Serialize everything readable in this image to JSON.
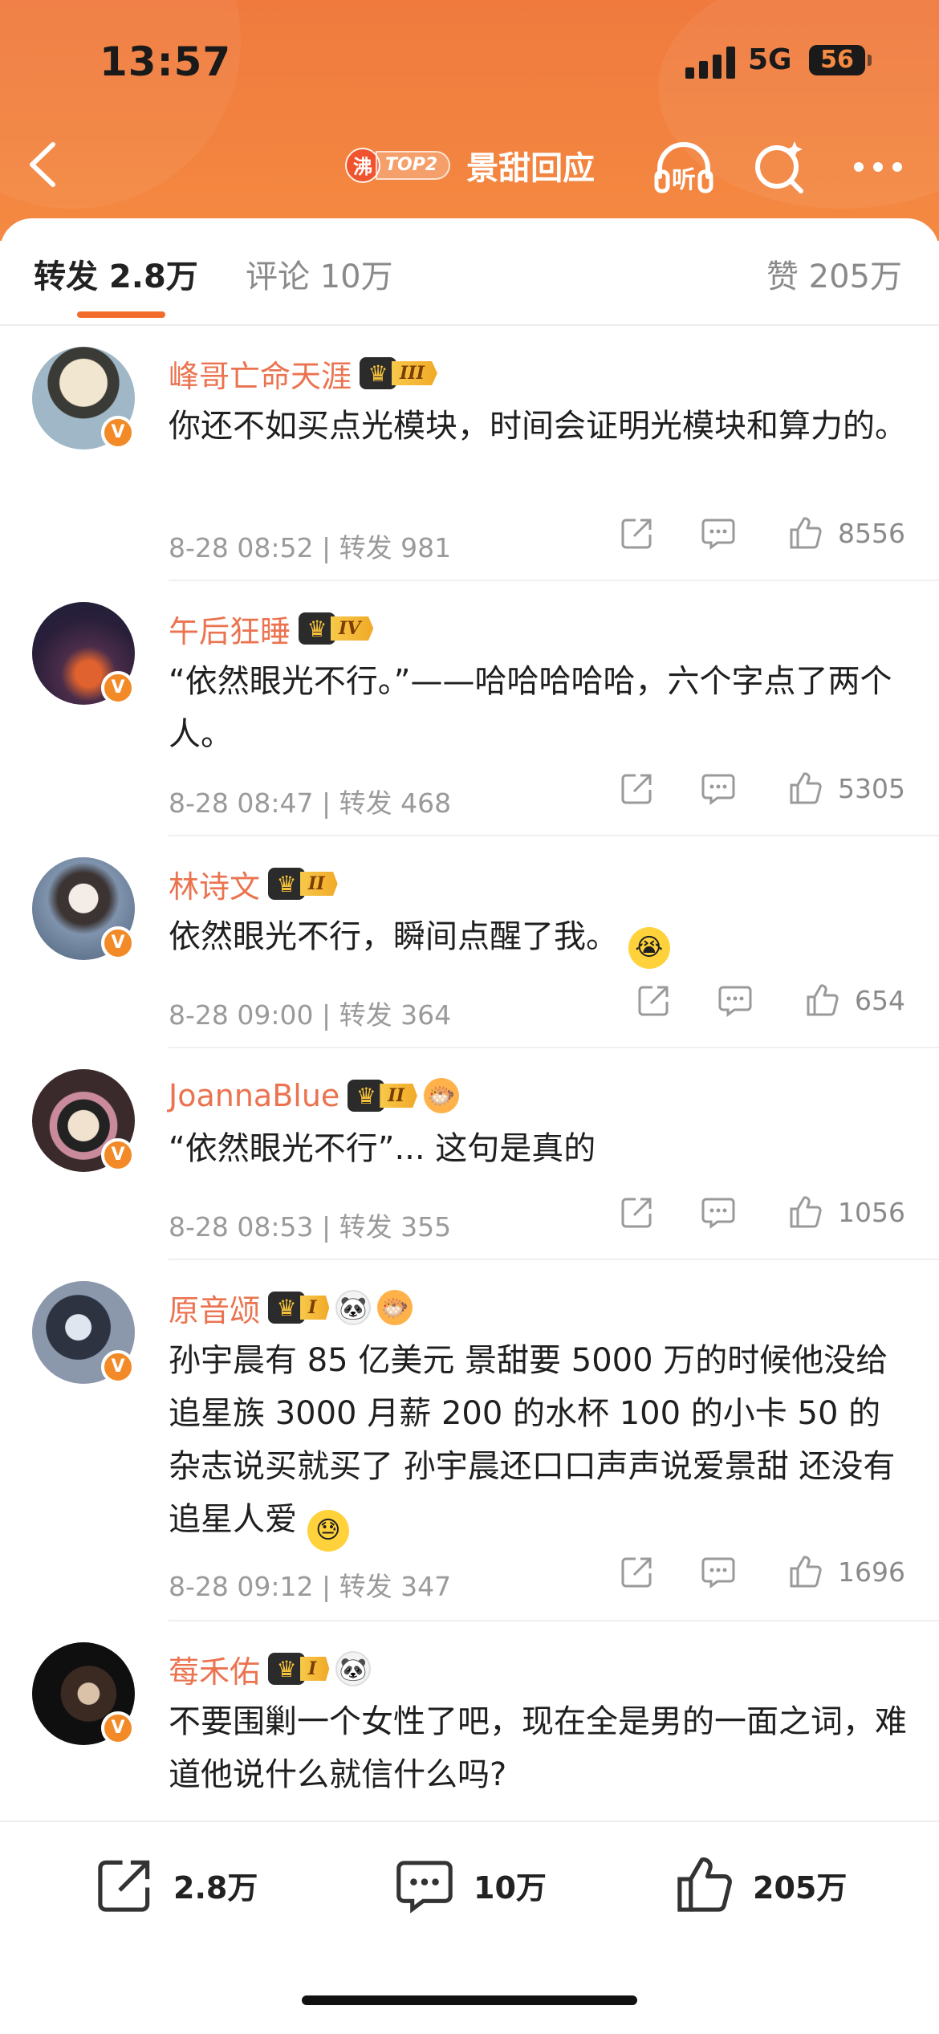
{
  "status_bar": {
    "time": "13:57",
    "network": "5G",
    "battery": "56"
  },
  "nav": {
    "hot_label": "沸",
    "rank_label": "TOP2",
    "title": "景甜回应",
    "listen_label": "听"
  },
  "tabs": {
    "repost": "转发 2.8万",
    "comment": "评论 10万",
    "like": "赞 205万"
  },
  "colors": {
    "accent": "#f36c2d",
    "username": "#eb7350",
    "header": "#f2823f"
  },
  "items": [
    {
      "name": "峰哥亡命天涯",
      "level": "III",
      "emblems": [],
      "text": "你还不如买点光模块，时间会证明光模块和算力的。",
      "meta": "8-28 08:52 | 转发 981",
      "likes": "8556"
    },
    {
      "name": "午后狂睡",
      "level": "IV",
      "emblems": [],
      "text": "“依然眼光不行。”——哈哈哈哈哈，六个字点了两个人。",
      "meta": "8-28 08:47 | 转发 468",
      "likes": "5305"
    },
    {
      "name": "林诗文",
      "level": "II",
      "emblems": [],
      "text": "依然眼光不行，瞬间点醒了我。",
      "emoji": "😭",
      "meta": "8-28 09:00 | 转发 364",
      "likes": "654"
    },
    {
      "name": "JoannaBlue",
      "level": "II",
      "emblems": [
        "fish-icon"
      ],
      "text": "“依然眼光不行”... 这句是真的",
      "meta": "8-28 08:53 | 转发 355",
      "likes": "1056"
    },
    {
      "name": "原音颂",
      "level": "I",
      "emblems": [
        "panda-icon",
        "fish-icon"
      ],
      "text": "孙宇晨有 85 亿美元 景甜要 5000 万的时候他没给 追星族 3000 月薪 200 的水杯 100 的小卡 50 的杂志说买就买了 孙宇晨还口口声声说爱景甜 还没有追星人爱",
      "emoji": "😓",
      "meta": "8-28 09:12 | 转发 347",
      "likes": "1696"
    },
    {
      "name": "莓禾佑",
      "level": "I",
      "emblems": [
        "panda-icon"
      ],
      "text": "不要围剿一个女性了吧，现在全是男的一面之词，难道他说什么就信什么吗?"
    }
  ],
  "bottom_bar": {
    "repost": "2.8万",
    "comment": "10万",
    "like": "205万"
  }
}
